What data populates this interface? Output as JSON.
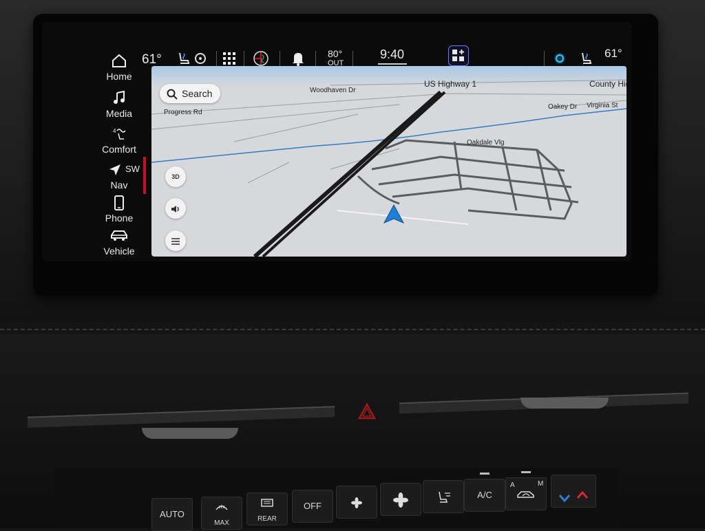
{
  "status_bar": {
    "driver_temp": "61°",
    "outside_temp": "80°",
    "outside_label": "OUT",
    "clock": "9:40",
    "passenger_temp": "61°"
  },
  "sidebar": {
    "items": [
      {
        "label": "Home",
        "icon": "home-icon"
      },
      {
        "label": "Media",
        "icon": "music-note-icon"
      },
      {
        "label": "Comfort",
        "icon": "comfort-icon"
      },
      {
        "label": "Nav",
        "icon": "navigation-arrow-icon",
        "heading": "SW"
      },
      {
        "label": "Phone",
        "icon": "phone-icon"
      },
      {
        "label": "Vehicle",
        "icon": "car-icon"
      }
    ]
  },
  "map": {
    "search_label": "Search",
    "view_mode": "3D",
    "roads": {
      "woodhaven": "Woodhaven Dr",
      "us_highway": "US Highway 1",
      "county_highway": "County Highw",
      "progress": "Progress Rd",
      "oakey": "Oakey Dr",
      "virginia": "Virginia St",
      "oakdale": "Oakdale Vlg"
    }
  },
  "climate": {
    "auto": "AUTO",
    "max": "MAX",
    "rear": "REAR",
    "off": "OFF",
    "ac": "A/C",
    "recirc_a": "A",
    "recirc_m": "M"
  },
  "colors": {
    "accent_red": "#c8102e",
    "position_arrow": "#1e7fd6",
    "map_background": "#d6d8dc",
    "water_line": "#2f7dc0"
  }
}
